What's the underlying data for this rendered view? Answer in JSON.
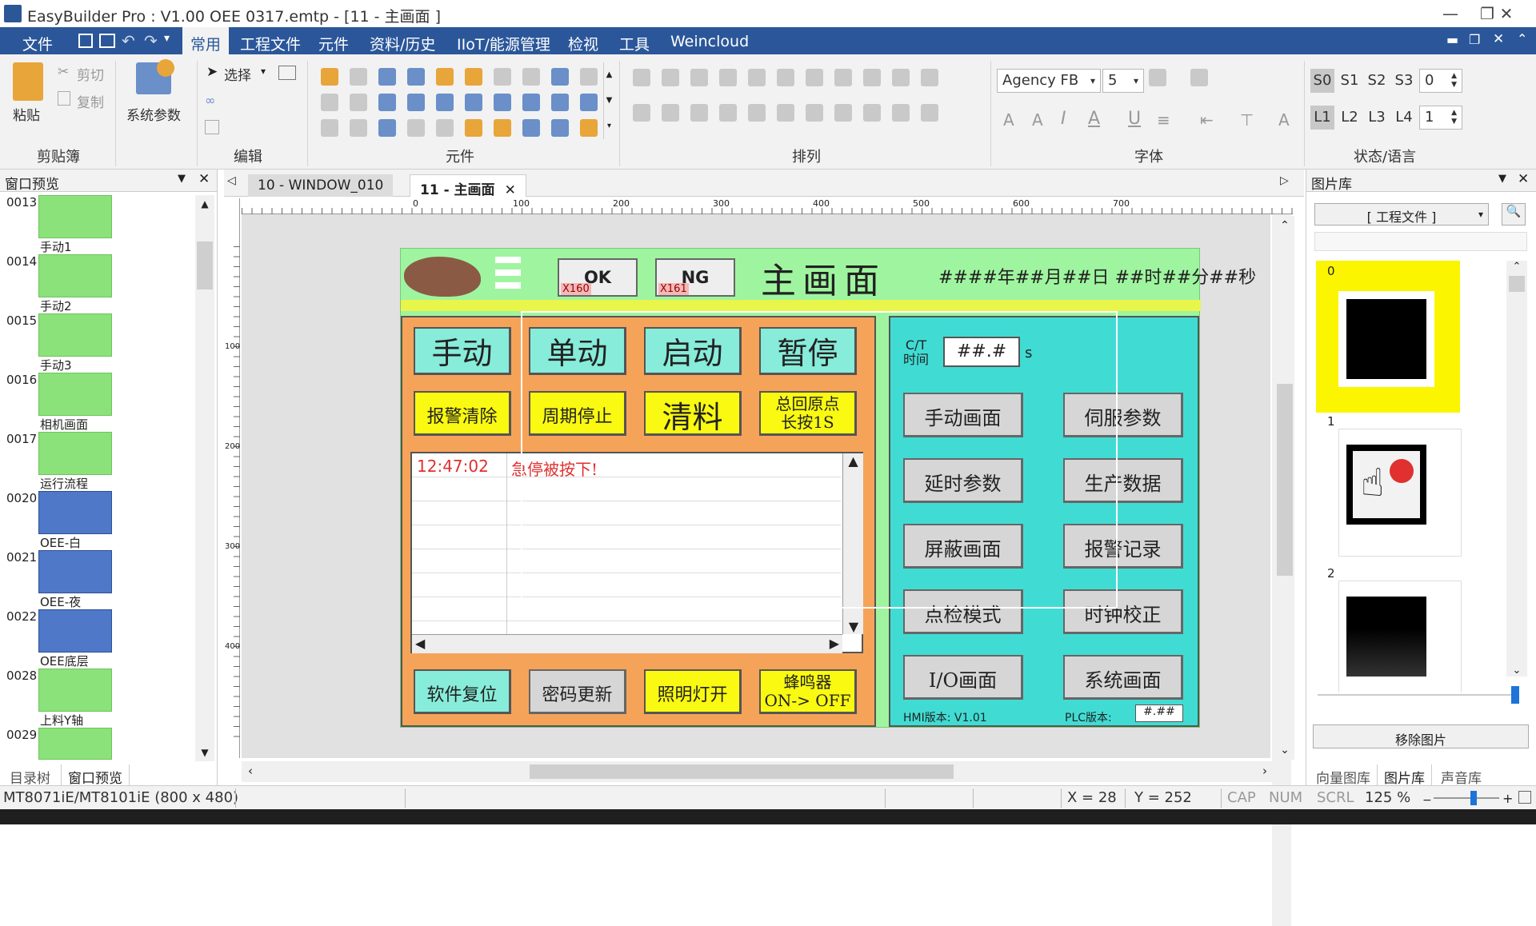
{
  "window": {
    "title": "EasyBuilder Pro : V1.00  OEE  0317.emtp - [11 - 主画面 ]"
  },
  "menu": {
    "items": [
      "文件",
      "常用",
      "工程文件",
      "元件",
      "资料/历史",
      "IIoT/能源管理",
      "检视",
      "工具",
      "Weincloud"
    ],
    "active": "常用"
  },
  "ribbon": {
    "paste": "粘贴",
    "cut": "剪切",
    "copy": "复制",
    "system_params": "系统参数",
    "select": "选择",
    "groups": {
      "clipboard": "剪贴簿",
      "edit": "编辑",
      "elements": "元件",
      "arrange": "排列",
      "font": "字体",
      "state": "状态/语言"
    },
    "font_name": "Agency FB",
    "font_size": "5",
    "states": [
      "S0",
      "S1",
      "S2",
      "S3"
    ],
    "langs": [
      "L1",
      "L2",
      "L3",
      "L4"
    ],
    "state_value": "0",
    "lang_value": "1"
  },
  "left_panel": {
    "title": "窗口预览",
    "items": [
      {
        "num": "0013",
        "name": "手动1"
      },
      {
        "num": "0014",
        "name": "手动2"
      },
      {
        "num": "0015",
        "name": "手动3"
      },
      {
        "num": "0016",
        "name": "相机画面"
      },
      {
        "num": "0017",
        "name": "运行流程"
      },
      {
        "num": "0020",
        "name": "OEE-白"
      },
      {
        "num": "0021",
        "name": "OEE-夜"
      },
      {
        "num": "0022",
        "name": "OEE底层"
      },
      {
        "num": "0028",
        "name": "上料Y轴"
      },
      {
        "num": "0029",
        "name": ""
      }
    ],
    "tabs": [
      "目录树",
      "窗口预览"
    ]
  },
  "editor": {
    "tabs": [
      "10 - WINDOW_010",
      "11 - 主画面"
    ],
    "ruler_marks": [
      "0",
      "100",
      "200",
      "300",
      "400",
      "500",
      "600",
      "700"
    ],
    "vruler_marks": [
      "100",
      "200",
      "300",
      "400"
    ]
  },
  "hmi": {
    "title": "主画面",
    "datetime": "####年##月##日 ##时##分##秒",
    "ok": {
      "label": "OK",
      "addr": "X160"
    },
    "ng": {
      "label": "NG",
      "addr": "X161"
    },
    "left_buttons": [
      {
        "label": "手动"
      },
      {
        "label": "单动"
      },
      {
        "label": "启动"
      },
      {
        "label": "暂停"
      }
    ],
    "second_row": {
      "alarm_clear": "报警清除",
      "cycle_stop": "周期停止",
      "clear": "清料",
      "home": "总回原点",
      "home_sub": "长按1S"
    },
    "alarm_time": "12:47:02",
    "alarm_msg": "急停被按下!",
    "bottom_buttons": {
      "reset": "软件复位",
      "pwd": "密码更新",
      "light": "照明灯开",
      "buzzer": "蜂鸣器",
      "buzzer_sub": "ON-> OFF"
    },
    "ct_label_top": "C/T",
    "ct_label_bottom": "时间",
    "ct_value": "##.#",
    "ct_unit": "s",
    "right_buttons": [
      "手动画面",
      "伺服参数",
      "延时参数",
      "生产数据",
      "屏蔽画面",
      "报警记录",
      "点检模式",
      "时钟校正",
      "I/O画面",
      "系统画面"
    ],
    "hmi_version": "HMI版本: V1.01",
    "plc_version_label": "PLC版本:",
    "plc_version_value": "#.##"
  },
  "right_panel": {
    "title": "图片库",
    "combo": "[ 工程文件 ]",
    "images": [
      "0",
      "1",
      "2"
    ],
    "remove": "移除图片",
    "tabs": [
      "向量图库",
      "图片库",
      "声音库"
    ]
  },
  "status": {
    "model": "MT8071iE/MT8101iE (800 x 480)",
    "x": "X = 28",
    "y": "Y = 252",
    "cap": "CAP",
    "num": "NUM",
    "scrl": "SCRL",
    "zoom": "125 %"
  }
}
